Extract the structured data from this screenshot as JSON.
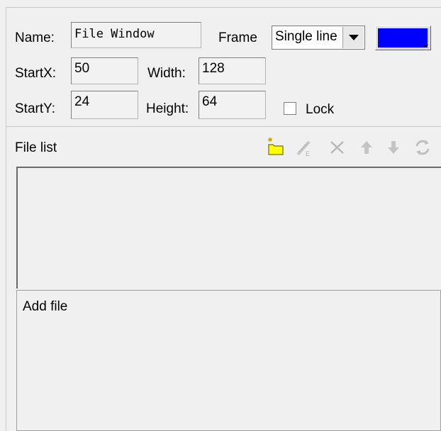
{
  "form": {
    "name_label": "Name:",
    "name_value": "File Window",
    "frame_label": "Frame",
    "frame_value": "Single line",
    "frame_color": "#0000ff",
    "startx_label": "StartX:",
    "startx_value": "50",
    "width_label": "Width:",
    "width_value": "128",
    "starty_label": "StartY:",
    "starty_value": "24",
    "height_label": "Height:",
    "height_value": "64",
    "lock_label": "Lock",
    "lock_checked": false
  },
  "file_list": {
    "label": "File list",
    "toolbar": [
      "add-file-icon",
      "edit-file-icon",
      "delete-icon",
      "move-up-icon",
      "move-down-icon",
      "refresh-icon"
    ],
    "items": []
  },
  "info": {
    "text": "Add file"
  }
}
